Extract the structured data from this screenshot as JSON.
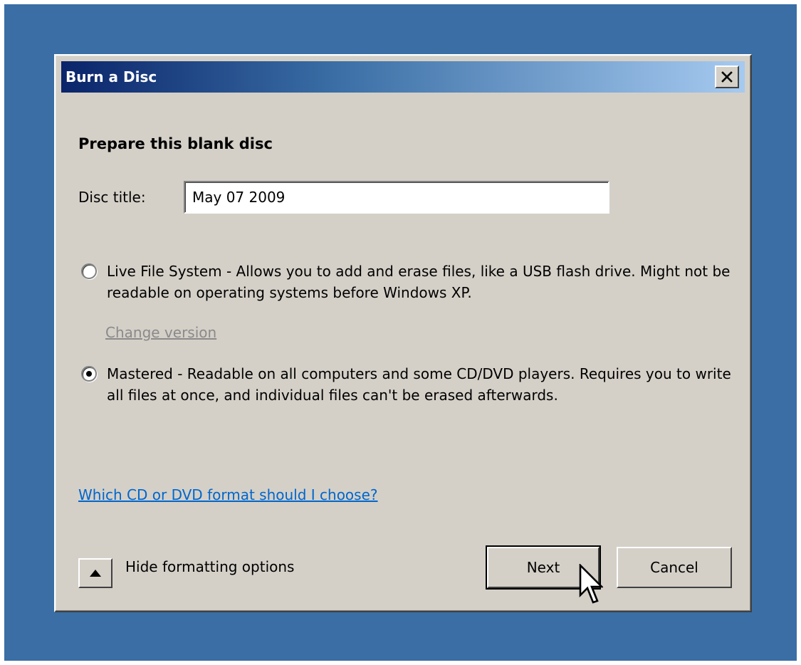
{
  "window": {
    "title": "Burn a Disc",
    "close_glyph": "✕"
  },
  "dialog": {
    "heading": "Prepare this blank disc",
    "disc_title_label": "Disc title:",
    "disc_title_value": "May 07 2009"
  },
  "options": [
    {
      "label": "Live File System - Allows you to add and erase files, like a USB flash drive. Might not be readable on operating systems before Windows XP.",
      "selected": false
    },
    {
      "label": "Mastered - Readable on all computers and some CD/DVD players. Requires you to write all files at once, and individual files can't be erased afterwards.",
      "selected": true
    }
  ],
  "links": {
    "change_version": "Change version",
    "help": "Which CD or DVD format should I choose?"
  },
  "footer": {
    "toggle_label": "Hide formatting options",
    "next_label": "Next",
    "cancel_label": "Cancel"
  },
  "colors": {
    "desktop": "#3a6ea5",
    "dialog_face": "#d4d0c8",
    "title_gradient_start": "#0a246a",
    "title_gradient_end": "#a6caf0",
    "link": "#0066cc",
    "disabled_link": "#8a8a8a"
  },
  "icons": {
    "close": "close-icon",
    "toggle": "triangle-up-icon",
    "cursor": "mouse-pointer-icon"
  }
}
